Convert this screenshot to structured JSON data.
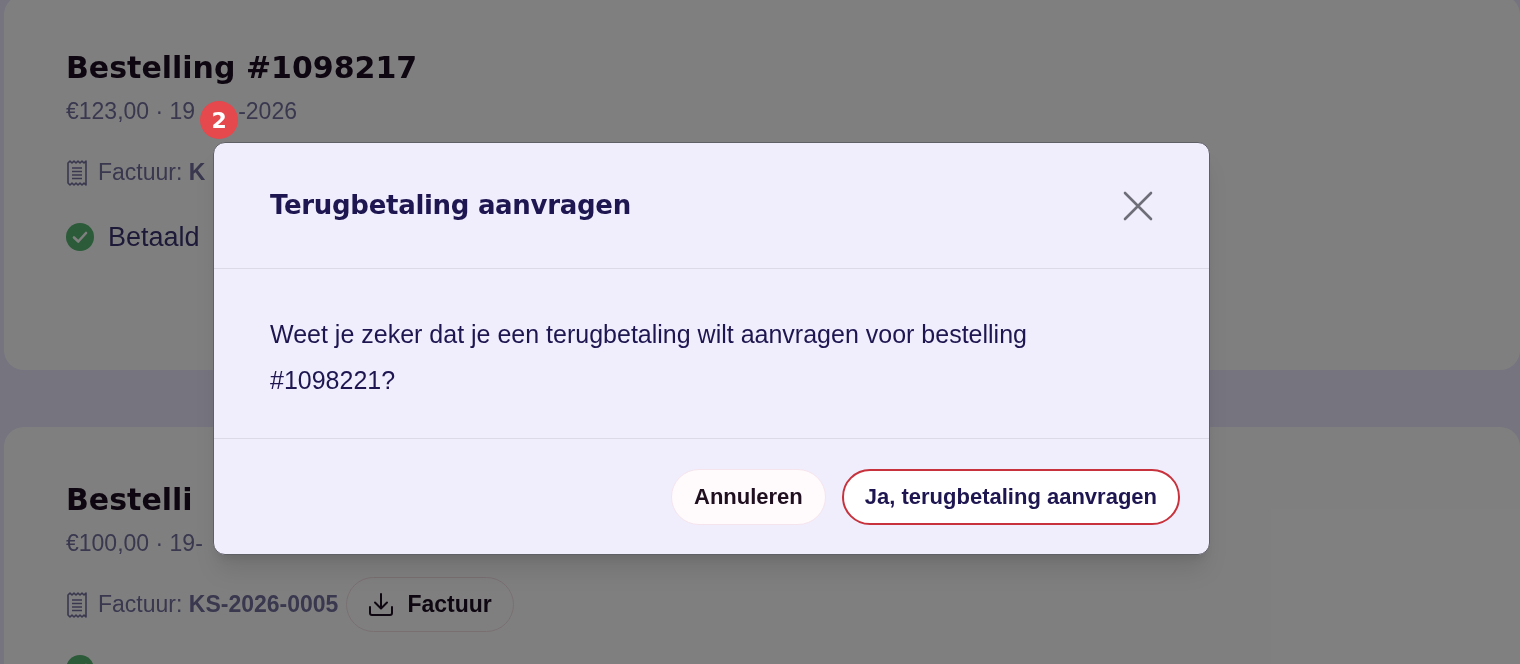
{
  "orders": [
    {
      "title": "Bestelling #1098217",
      "summary": [
        "€123,00 · 19",
        "-2026"
      ],
      "invoice": "Factuur: **K**",
      "status": {
        "kind": "paid",
        "label": "Betaald"
      }
    },
    {
      "title": "Bestelli",
      "summary": [
        "€100,00 · 19-"
      ],
      "invoice": "Factuur: **KS-2026-0005**",
      "invoice_button": "Factuur",
      "status": {
        "kind": "paid"
      }
    }
  ],
  "badge": {
    "count": "2"
  },
  "dialog": {
    "title": "Terugbetaling aanvragen",
    "message": "Weet je zeker dat je een terugbetaling wilt aanvragen voor bestelling #1098221?",
    "buttons": [
      {
        "label": "Annuleren",
        "kind": "secondary"
      },
      {
        "label": "Ja, terugbetaling aanvragen",
        "kind": "primary"
      }
    ]
  }
}
